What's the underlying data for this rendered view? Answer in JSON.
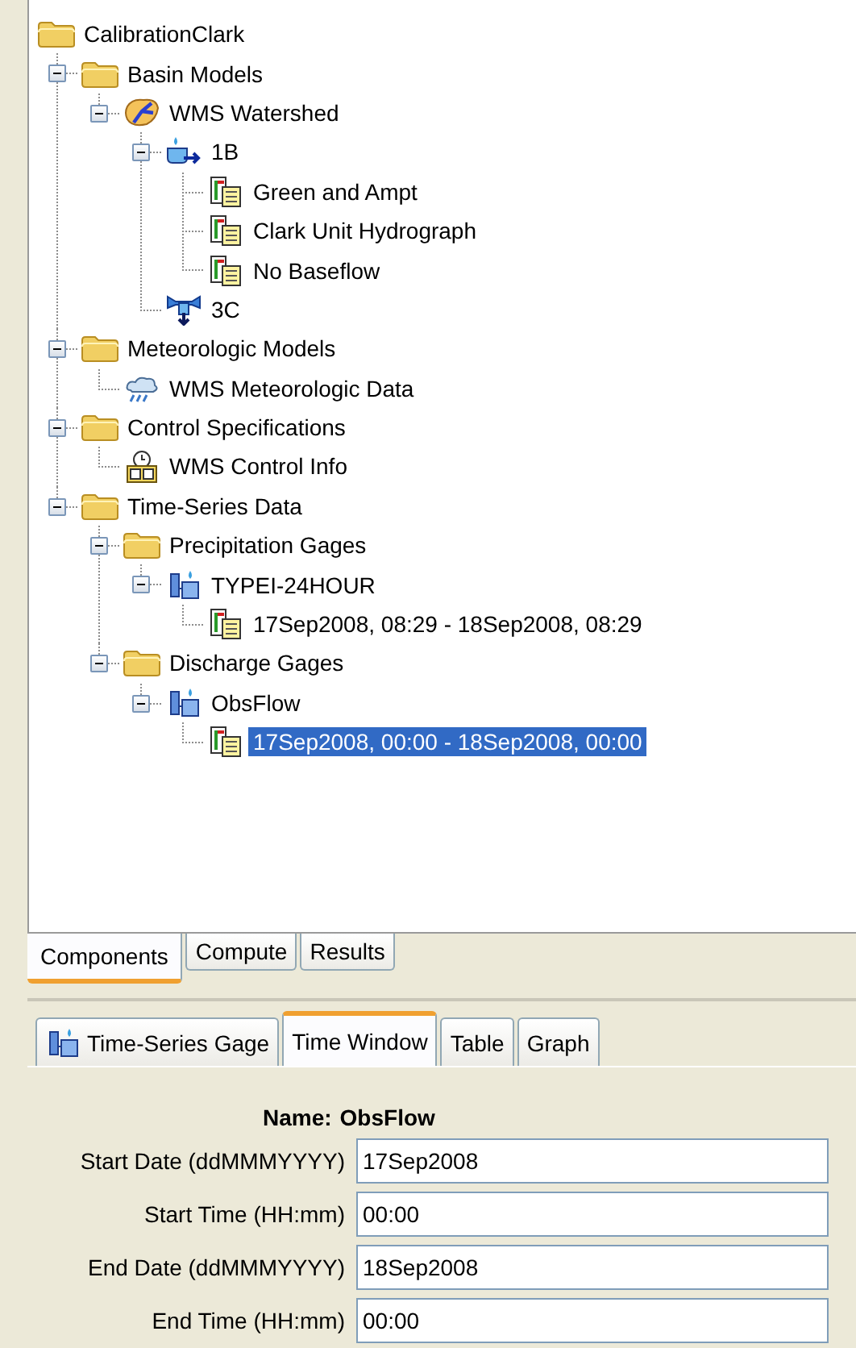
{
  "tree": {
    "label": "CalibrationClark",
    "kind": "folder",
    "selected": false,
    "children": [
      {
        "label": "Basin Models",
        "kind": "folder",
        "expanded": true,
        "selected": false,
        "children": [
          {
            "label": "WMS Watershed",
            "kind": "basin",
            "expanded": true,
            "selected": false,
            "children": [
              {
                "label": "1B",
                "kind": "subbasin",
                "expanded": true,
                "selected": false,
                "children": [
                  {
                    "label": "Green and Ampt",
                    "kind": "method",
                    "selected": false
                  },
                  {
                    "label": "Clark Unit Hydrograph",
                    "kind": "method",
                    "selected": false
                  },
                  {
                    "label": "No Baseflow",
                    "kind": "method",
                    "selected": false
                  }
                ]
              },
              {
                "label": "3C",
                "kind": "junction",
                "selected": false
              }
            ]
          }
        ]
      },
      {
        "label": "Meteorologic Models",
        "kind": "folder",
        "expanded": true,
        "selected": false,
        "children": [
          {
            "label": "WMS Meteorologic Data",
            "kind": "meteorology",
            "selected": false
          }
        ]
      },
      {
        "label": "Control Specifications",
        "kind": "folder",
        "expanded": true,
        "selected": false,
        "children": [
          {
            "label": "WMS Control Info",
            "kind": "control",
            "selected": false
          }
        ]
      },
      {
        "label": "Time-Series Data",
        "kind": "folder",
        "expanded": true,
        "selected": false,
        "children": [
          {
            "label": "Precipitation Gages",
            "kind": "folder",
            "expanded": true,
            "selected": false,
            "children": [
              {
                "label": "TYPEI-24HOUR",
                "kind": "gage",
                "expanded": true,
                "selected": false,
                "children": [
                  {
                    "label": "17Sep2008, 08:29 - 18Sep2008, 08:29",
                    "kind": "method",
                    "selected": false
                  }
                ]
              }
            ]
          },
          {
            "label": "Discharge Gages",
            "kind": "folder",
            "expanded": true,
            "selected": false,
            "children": [
              {
                "label": "ObsFlow",
                "kind": "gage",
                "expanded": true,
                "selected": false,
                "children": [
                  {
                    "label": "17Sep2008, 00:00 - 18Sep2008, 00:00",
                    "kind": "method",
                    "selected": true
                  }
                ]
              }
            ]
          }
        ]
      }
    ]
  },
  "explorer_tabs": [
    {
      "label": "Components",
      "selected": true
    },
    {
      "label": "Compute",
      "selected": false
    },
    {
      "label": "Results",
      "selected": false
    }
  ],
  "editor_tabs": [
    {
      "label": "Time-Series Gage",
      "kind": "gage",
      "selected": false
    },
    {
      "label": "Time Window",
      "selected": true
    },
    {
      "label": "Table",
      "selected": false
    },
    {
      "label": "Graph",
      "selected": false
    }
  ],
  "form": {
    "name_label": "Name:",
    "name_value": "ObsFlow",
    "fields": [
      {
        "label": "Start Date (ddMMMYYYY)",
        "value": "17Sep2008"
      },
      {
        "label": "Start Time (HH:mm)",
        "value": "00:00"
      },
      {
        "label": "End Date (ddMMMYYYY)",
        "value": "18Sep2008"
      },
      {
        "label": "End Time (HH:mm)",
        "value": "00:00"
      }
    ]
  }
}
